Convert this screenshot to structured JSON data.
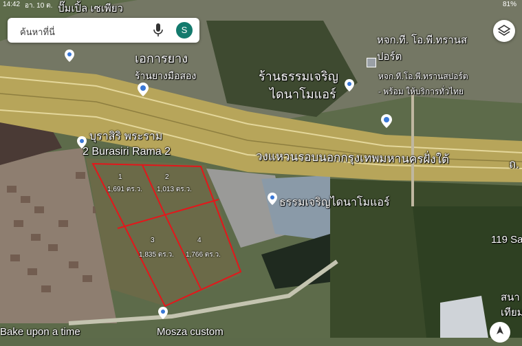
{
  "status_bar": {
    "time": "14:42",
    "date": "อา. 10 ต.",
    "battery": "81%"
  },
  "search": {
    "placeholder": "ค้นหาที่นี่",
    "avatar_letter": "S"
  },
  "map_labels": {
    "top_cut": "ปั๊มเปิ้ล เซเพียว",
    "rubber_shop_title": "เอการยาง",
    "rubber_shop_sub": "ร้านยางมือสอง",
    "tanjaroen_top": "ร้านธรรมเจริญ",
    "tanjaroen_top_2": "ไดนาโมแอร์",
    "transport_1": "หจก.ที. โอ.พี.ทรานส",
    "transport_2": "ปอร์ต",
    "transport_3": "หจก.ที.โอ.พี.ทรานสปอร์ต",
    "transport_4": "- พร้อม ให้บริการทั่วไทย",
    "burasiri_th": "บุราสิริ พระราม",
    "burasiri_en": "2 Burasiri Rama 2",
    "ring_road": "วงแหวนรอบนอกกรุงเทพมหานครฝั่งใต้",
    "ring_road_tail": "ถ.",
    "tanjaroen_mid": "ธรรมเจริญไดนาโมแอร์",
    "right_119": "119 Sa",
    "right_sana": "สนา",
    "right_thiam": "เทียม",
    "bottom_left": "Bake upon a time",
    "bottom_mid": "Mosza custom"
  },
  "parcels": [
    {
      "number": "1",
      "area": "1,691 ตร.ว."
    },
    {
      "number": "2",
      "area": "1,013 ตร.ว."
    },
    {
      "number": "3",
      "area": "1,835 ตร.ว."
    },
    {
      "number": "4",
      "area": "1,766 ตร.ว."
    }
  ],
  "colors": {
    "parcel_outline": "#e4161b",
    "road": "#b8a75a",
    "pin": "#ffffff"
  },
  "icons": [
    "mic-icon",
    "layers-icon",
    "location-pin-icon",
    "shopping-cart-icon",
    "compass-icon"
  ]
}
